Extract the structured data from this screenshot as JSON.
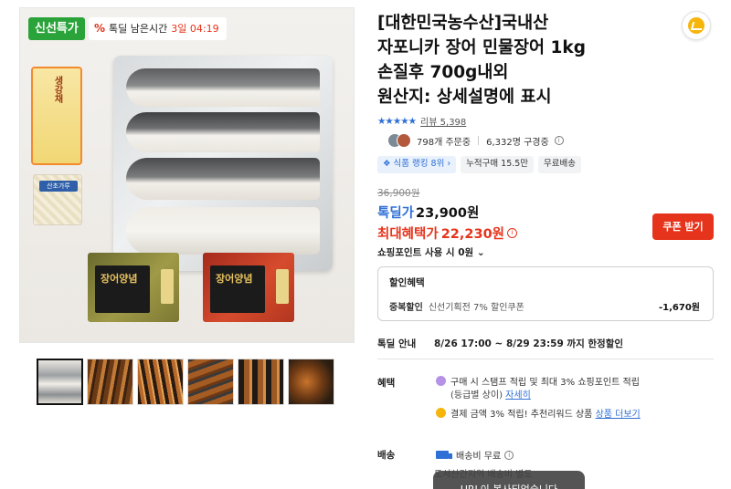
{
  "image": {
    "fresh_badge": "신선특가",
    "timer_label": "톡딜 남은시간",
    "timer_value": "3일 04:19",
    "ginger_label": "생강채",
    "pepper_label": "산초가루",
    "sauce1_label": "장어양념",
    "sauce2_label": "장어양념"
  },
  "thumbnails": [
    "thumb-1",
    "thumb-2",
    "thumb-3",
    "thumb-4",
    "thumb-5",
    "thumb-6"
  ],
  "product": {
    "title_lines": [
      "[대한민국농수산]국내산",
      "자포니카 장어 민물장어 1kg",
      "손질후 700g내외",
      "원산지: 상세설명에 표시"
    ],
    "stars": "★★★★★",
    "review": "리뷰 5,398",
    "orders": "798개 주문중",
    "subscribers": "6,332명 구경중",
    "tags": [
      "식품 랭킹 8위",
      "누적구매 15.5만",
      "무료배송"
    ],
    "original_price": "36,900원",
    "deal_label": "톡딜가",
    "deal_price": "23,900원",
    "max_label": "최대혜택가",
    "max_price": "22,230원",
    "coupon_button": "쿠폰 받기",
    "points": "쇼핑포인트 사용 시 0원",
    "discount_header": "할인혜택",
    "discount_key": "중복할인",
    "discount_desc": "신선기획전 7% 할인쿠폰",
    "discount_amount": "-1,670원",
    "deal_info_label": "톡딜 안내",
    "deal_info_value": "8/26 17:00 ~ 8/29 23:59 까지 한정할인",
    "benefit_label": "혜택",
    "benefit1": "구매 시 스탬프 적립 및 최대 3% 쇼핑포인트 적립",
    "benefit1_sub": "(등급별 상이)",
    "benefit1_link": "자세히",
    "benefit2": "결제 금액 3% 적립! 추천리워드 상품",
    "benefit2_link": "상품 더보기",
    "delivery_label": "배송",
    "delivery_value": "배송비 무료",
    "delivery_sub": "도서산간지역 배송비 별도",
    "toast": "URL이 복사되었습니다"
  }
}
